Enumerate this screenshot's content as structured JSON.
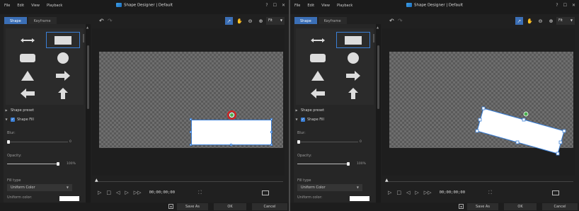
{
  "menu": [
    "File",
    "Edit",
    "View",
    "Playback"
  ],
  "window_title": "Shape Designer | Default",
  "window_controls": [
    "?",
    "☐",
    "✕"
  ],
  "tabs": [
    {
      "label": "Shape",
      "active": true
    },
    {
      "label": "Keyframe",
      "active": false
    }
  ],
  "sections": {
    "shape_preset": "Shape preset",
    "shape_fill": "Shape Fill"
  },
  "fill": {
    "blur_label": "Blur:",
    "blur_value": "0",
    "opacity_label": "Opacity:",
    "opacity_value": "100%",
    "fill_type_label": "Fill type",
    "fill_type_value": "Uniform Color",
    "uniform_color_label": "Uniform color:",
    "uniform_color_hex": "#ffffff"
  },
  "zoom": "Fit",
  "timecode": "00;00;00;00",
  "buttons": {
    "save_as": "Save As",
    "ok": "OK",
    "cancel": "Cancel"
  },
  "colors": {
    "accent": "#3b7fd6",
    "selected_tab": "#3b6fb6",
    "rotation_handle": "#4caf50",
    "highlight_ring": "#d92020"
  },
  "icons": {
    "shapes": [
      "double-arrow",
      "rectangle",
      "rounded-rectangle",
      "circle",
      "triangle",
      "right-arrow",
      "left-arrow",
      "up-arrow"
    ],
    "tools": [
      "select-icon",
      "hand-icon",
      "zoom-out-icon",
      "zoom-in-icon"
    ]
  }
}
